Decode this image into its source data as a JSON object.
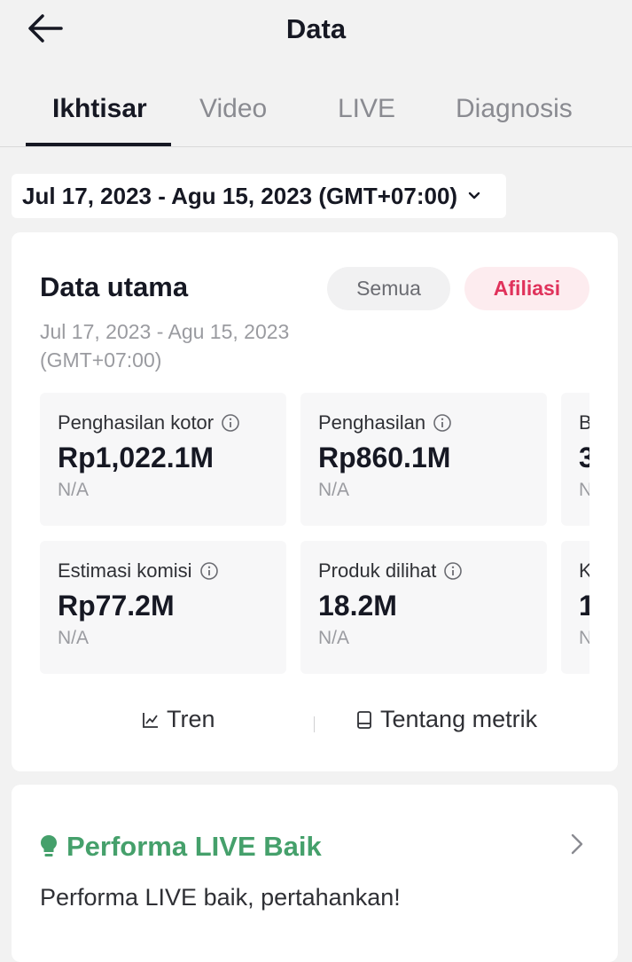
{
  "header": {
    "back_icon": "arrow-left-icon",
    "title": "Data"
  },
  "tabs": [
    {
      "label": "Ikhtisar",
      "active": true
    },
    {
      "label": "Video",
      "active": false
    },
    {
      "label": "LIVE",
      "active": false
    },
    {
      "label": "Diagnosis",
      "active": false
    }
  ],
  "date_range": {
    "label": "Jul 17, 2023 - Agu 15, 2023 (GMT+07:00)",
    "chevron_icon": "chevron-down-icon"
  },
  "main_data": {
    "title": "Data utama",
    "filters": [
      {
        "label": "Semua",
        "selected": false
      },
      {
        "label": "Afiliasi",
        "selected": true
      }
    ],
    "date_line1": "Jul 17, 2023 - Agu 15, 2023",
    "date_line2": "(GMT+07:00)",
    "metrics": [
      {
        "label": "Penghasilan kotor",
        "value": "Rp1,022.1M",
        "sub": "N/A"
      },
      {
        "label": "Penghasilan",
        "value": "Rp860.1M",
        "sub": "N/A"
      },
      {
        "label": "B",
        "value": "3",
        "sub": "N"
      },
      {
        "label": "Estimasi komisi",
        "value": "Rp77.2M",
        "sub": "N/A"
      },
      {
        "label": "Produk dilihat",
        "value": "18.2M",
        "sub": "N/A"
      },
      {
        "label": "K",
        "value": "1",
        "sub": "N"
      }
    ],
    "links": {
      "trend": {
        "label": "Tren",
        "icon": "line-chart-icon"
      },
      "about": {
        "label": "Tentang metrik",
        "icon": "book-icon"
      }
    }
  },
  "live_performance": {
    "title": "Performa LIVE Baik",
    "description": "Performa LIVE baik, pertahankan!",
    "icon": "lightbulb-icon",
    "chevron_icon": "chevron-right-icon"
  },
  "colors": {
    "accent_pink": "#e0325b",
    "accent_pink_bg": "#fdecef",
    "success_green": "#45a06b"
  }
}
